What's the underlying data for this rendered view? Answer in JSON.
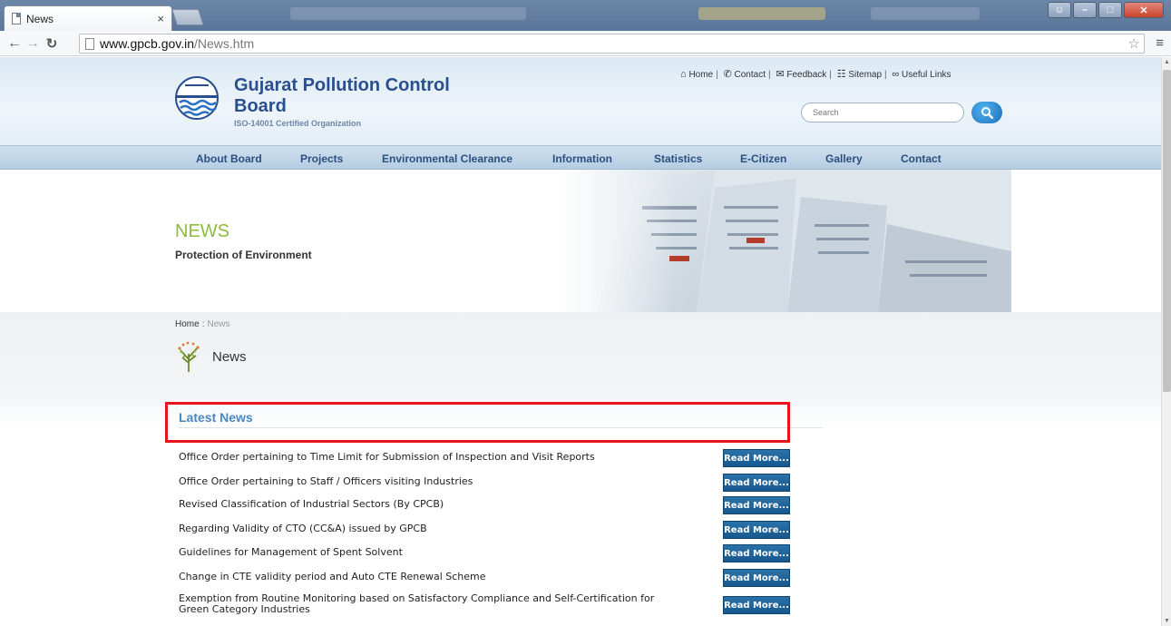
{
  "browser": {
    "tab_title": "News",
    "tab_close": "×",
    "url_host": "www.gpcb.gov.in",
    "url_path": "/News.htm"
  },
  "header": {
    "org_name": "Gujarat Pollution Control Board",
    "org_subtitle": "ISO-14001 Certified Organization",
    "top_links": [
      {
        "label": "Home",
        "icon": "home-icon"
      },
      {
        "label": "Contact",
        "icon": "phone-icon"
      },
      {
        "label": "Feedback",
        "icon": "mail-icon"
      },
      {
        "label": "Sitemap",
        "icon": "sitemap-icon"
      },
      {
        "label": "Useful Links",
        "icon": "link-icon"
      }
    ],
    "search_placeholder": "Search"
  },
  "nav": [
    "About Board",
    "Projects",
    "Environmental Clearance",
    "Information",
    "Statistics",
    "E-Citizen",
    "Gallery",
    "Contact"
  ],
  "banner": {
    "title": "NEWS",
    "subtitle": "Protection of Environment"
  },
  "breadcrumb": {
    "home": "Home",
    "separator": ":",
    "current": "News"
  },
  "section_title": "News",
  "latest_title": "Latest News",
  "read_more_label": "Read More...",
  "news": [
    "Office Order pertaining to Time Limit for Submission of Inspection and Visit Reports",
    "Office Order pertaining to Staff / Officers visiting Industries",
    "Revised Classification of Industrial Sectors (By CPCB)",
    "Regarding Validity of CTO (CC&A) issued by GPCB",
    "Guidelines for Management of Spent Solvent",
    "Change in CTE validity period and Auto CTE Renewal Scheme",
    "Exemption from Routine Monitoring based on Satisfactory Compliance and Self-Certification for Green Category Industries"
  ],
  "colors": {
    "accent_blue": "#2a4f8f",
    "news_green": "#8dbb3d",
    "button_blue": "#1f649a",
    "highlight_red": "#e8141c"
  }
}
